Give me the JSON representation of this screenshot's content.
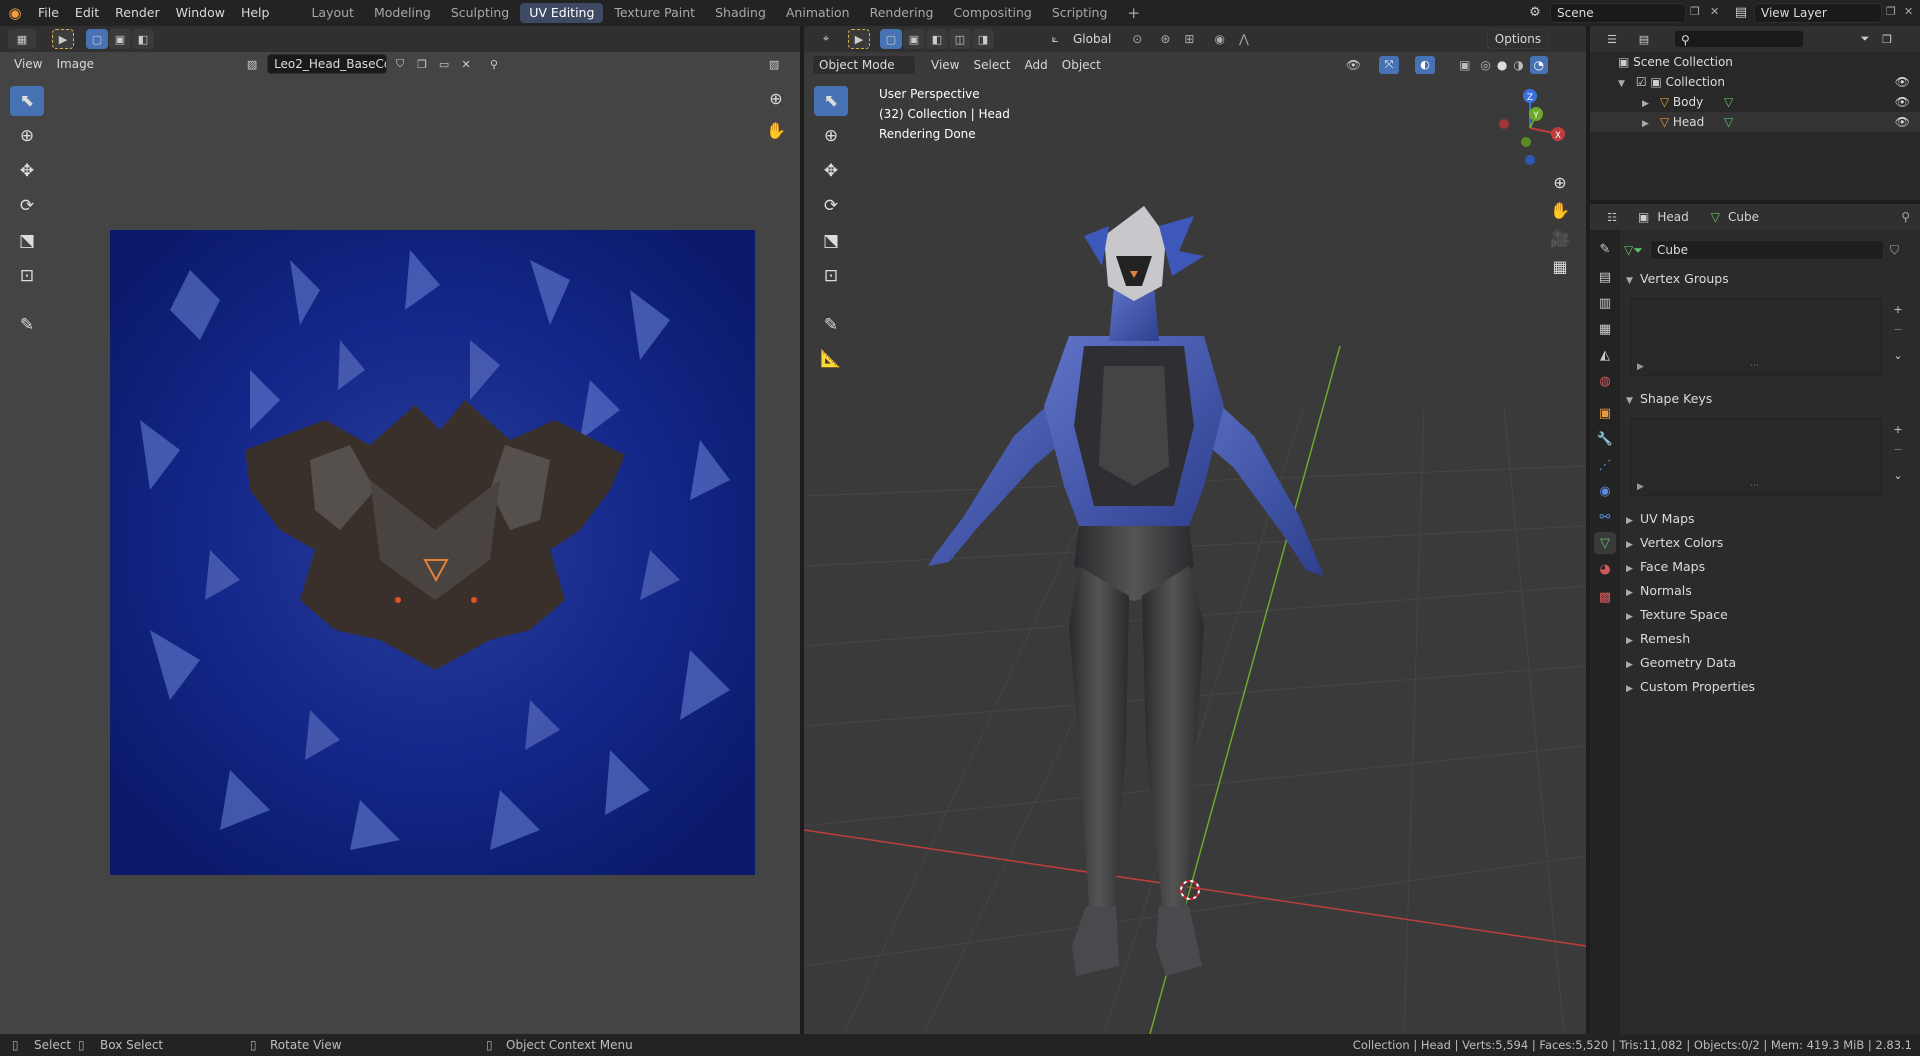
{
  "app": {
    "menu": [
      "File",
      "Edit",
      "Render",
      "Window",
      "Help"
    ],
    "workspaces": [
      "Layout",
      "Modeling",
      "Sculpting",
      "UV Editing",
      "Texture Paint",
      "Shading",
      "Animation",
      "Rendering",
      "Compositing",
      "Scripting"
    ],
    "active_workspace": "UV Editing",
    "add_workspace": "+",
    "scene": "Scene",
    "view_layer": "View Layer"
  },
  "uv_editor": {
    "menus": [
      "View",
      "Image"
    ],
    "image_name": "Leo2_Head_BaseCol...",
    "colors": {
      "texture_bg": "#0e1f7a",
      "face": "#3a302b",
      "eyes": "#e2502a"
    }
  },
  "viewport": {
    "mode": "Object Mode",
    "menus": [
      "View",
      "Select",
      "Add",
      "Object"
    ],
    "transform_orientation": "Global",
    "options_label": "Options",
    "overlay_lines": [
      "User Perspective",
      "(32) Collection | Head",
      "Rendering Done"
    ],
    "axis_labels": {
      "x": "X",
      "y": "Y",
      "z": "Z"
    },
    "colors": {
      "x_axis": "#c03d3d",
      "y_axis": "#6da82a",
      "z_axis": "#3b6fe0",
      "grid": "#3d3d3d"
    }
  },
  "outliner": {
    "search_placeholder": "",
    "items": [
      {
        "label": "Scene Collection",
        "level": 0
      },
      {
        "label": "Collection",
        "level": 1
      },
      {
        "label": "Body",
        "level": 2
      },
      {
        "label": "Head",
        "level": 2
      }
    ]
  },
  "properties": {
    "object_name": "Head",
    "data_name": "Cube",
    "mesh_field": "Cube",
    "open_panels": [
      "Vertex Groups",
      "Shape Keys"
    ],
    "closed_panels": [
      "UV Maps",
      "Vertex Colors",
      "Face Maps",
      "Normals",
      "Texture Space",
      "Remesh",
      "Geometry Data",
      "Custom Properties"
    ]
  },
  "statusbar": {
    "select": "Select",
    "box_select": "Box Select",
    "rotate_view": "Rotate View",
    "context_menu": "Object Context Menu",
    "stats": "Collection | Head | Verts:5,594 | Faces:5,520 | Tris:11,082 | Objects:0/2 | Mem: 419.3 MiB | 2.83.1"
  }
}
